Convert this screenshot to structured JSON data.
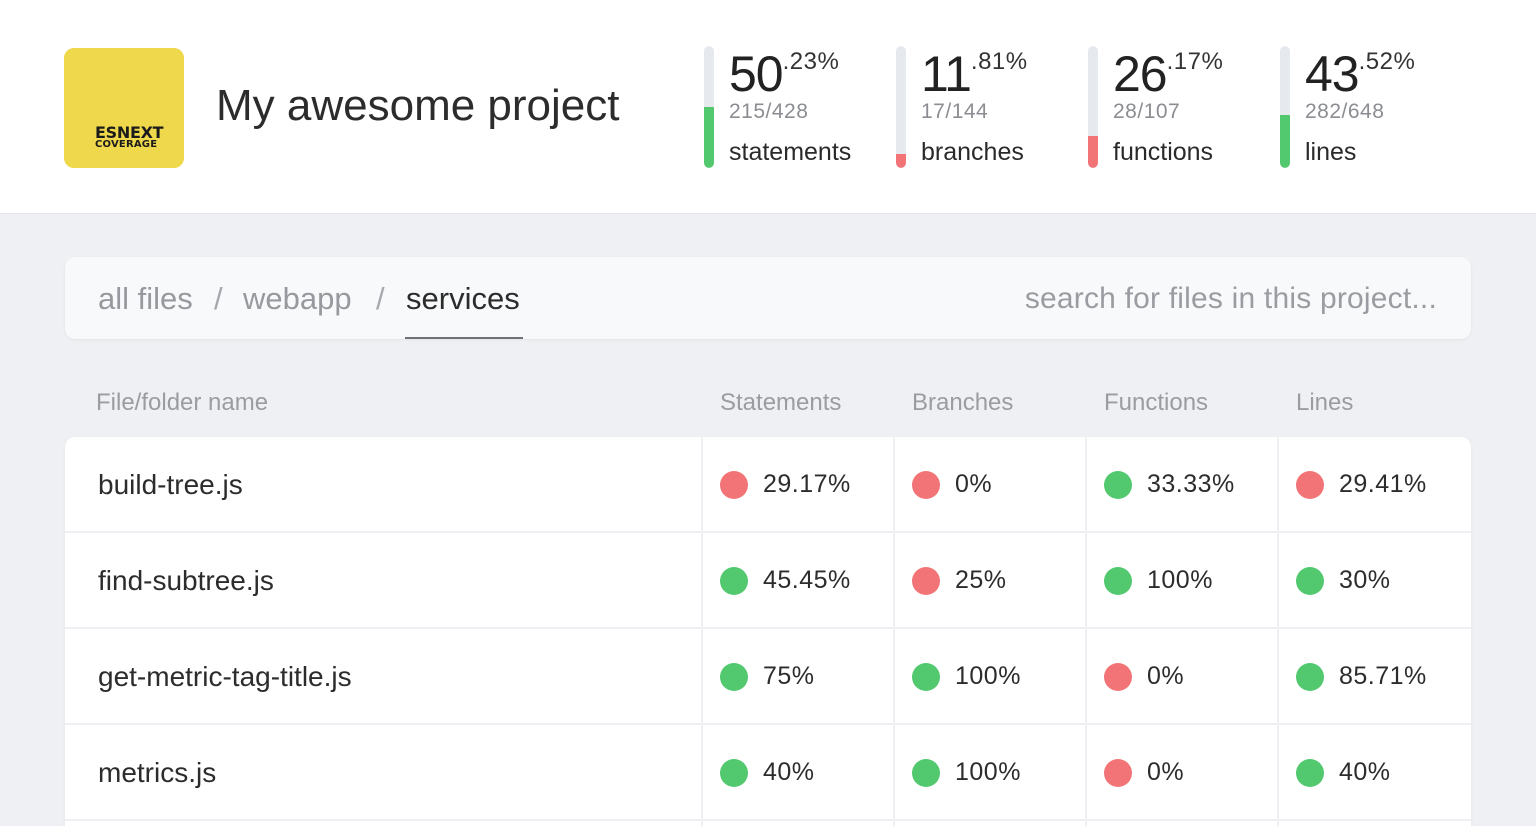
{
  "colors": {
    "good": "#52c96f",
    "bad": "#f27476",
    "logo_bg": "#efd84b"
  },
  "logo": {
    "line1": "ESNEXT",
    "line2": "COVERAGE"
  },
  "project": {
    "title": "My awesome project"
  },
  "metrics": [
    {
      "int": "50",
      "dec": ".23%",
      "count": "215/428",
      "label": "statements",
      "fill_pct": 50.23,
      "status": "good"
    },
    {
      "int": "11",
      "dec": ".81%",
      "count": "17/144",
      "label": "branches",
      "fill_pct": 11.81,
      "status": "bad"
    },
    {
      "int": "26",
      "dec": ".17%",
      "count": "28/107",
      "label": "functions",
      "fill_pct": 26.17,
      "status": "bad"
    },
    {
      "int": "43",
      "dec": ".52%",
      "count": "282/648",
      "label": "lines",
      "fill_pct": 43.52,
      "status": "good"
    }
  ],
  "breadcrumb": {
    "items": [
      "all files",
      "webapp",
      "services"
    ],
    "separator": "/"
  },
  "search": {
    "placeholder": "search for files in this project...",
    "value": ""
  },
  "table": {
    "headers": [
      "File/folder name",
      "Statements",
      "Branches",
      "Functions",
      "Lines"
    ],
    "rows": [
      {
        "name": "build-tree.js",
        "cells": [
          {
            "value": "29.17%",
            "status": "bad"
          },
          {
            "value": "0%",
            "status": "bad"
          },
          {
            "value": "33.33%",
            "status": "good"
          },
          {
            "value": "29.41%",
            "status": "bad"
          }
        ]
      },
      {
        "name": "find-subtree.js",
        "cells": [
          {
            "value": "45.45%",
            "status": "good"
          },
          {
            "value": "25%",
            "status": "bad"
          },
          {
            "value": "100%",
            "status": "good"
          },
          {
            "value": "30%",
            "status": "good"
          }
        ]
      },
      {
        "name": "get-metric-tag-title.js",
        "cells": [
          {
            "value": "75%",
            "status": "good"
          },
          {
            "value": "100%",
            "status": "good"
          },
          {
            "value": "0%",
            "status": "bad"
          },
          {
            "value": "85.71%",
            "status": "good"
          }
        ]
      },
      {
        "name": "metrics.js",
        "cells": [
          {
            "value": "40%",
            "status": "good"
          },
          {
            "value": "100%",
            "status": "good"
          },
          {
            "value": "0%",
            "status": "bad"
          },
          {
            "value": "40%",
            "status": "good"
          }
        ]
      }
    ]
  }
}
